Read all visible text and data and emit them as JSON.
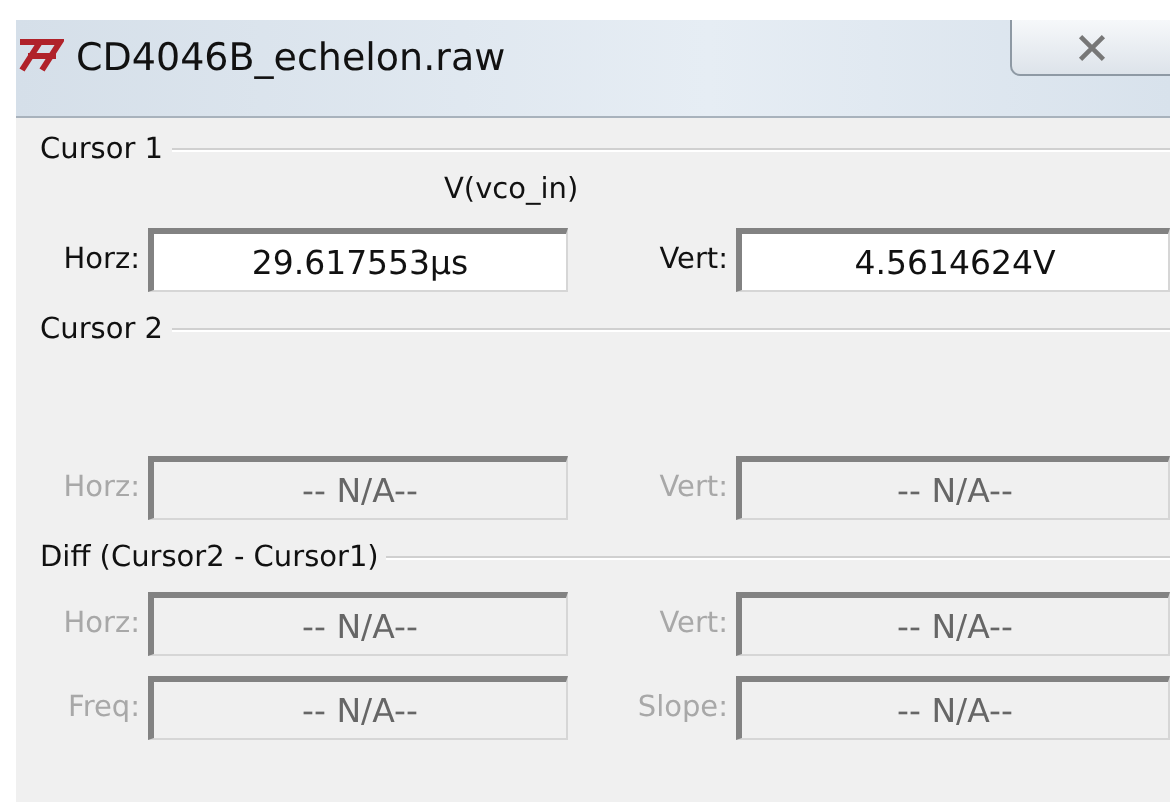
{
  "window": {
    "title": "CD4046B_echelon.raw"
  },
  "sections": [
    {
      "title": "Cursor 1",
      "signal": "V(vco_in)",
      "rows": [
        [
          {
            "label": "Horz:",
            "value": "29.617553µs",
            "disabled": false
          },
          {
            "label": "Vert:",
            "value": "4.5614624V",
            "disabled": false
          }
        ]
      ]
    },
    {
      "title": "Cursor 2",
      "rows": [
        [
          {
            "label": "Horz:",
            "value": "-- N/A--",
            "disabled": true
          },
          {
            "label": "Vert:",
            "value": "-- N/A--",
            "disabled": true
          }
        ]
      ]
    },
    {
      "title": "Diff (Cursor2 - Cursor1)",
      "rows": [
        [
          {
            "label": "Horz:",
            "value": "-- N/A--",
            "disabled": true
          },
          {
            "label": "Vert:",
            "value": "-- N/A--",
            "disabled": true
          }
        ],
        [
          {
            "label": "Freq:",
            "value": "-- N/A--",
            "disabled": true
          },
          {
            "label": "Slope:",
            "value": "-- N/A--",
            "disabled": true
          }
        ]
      ]
    }
  ]
}
